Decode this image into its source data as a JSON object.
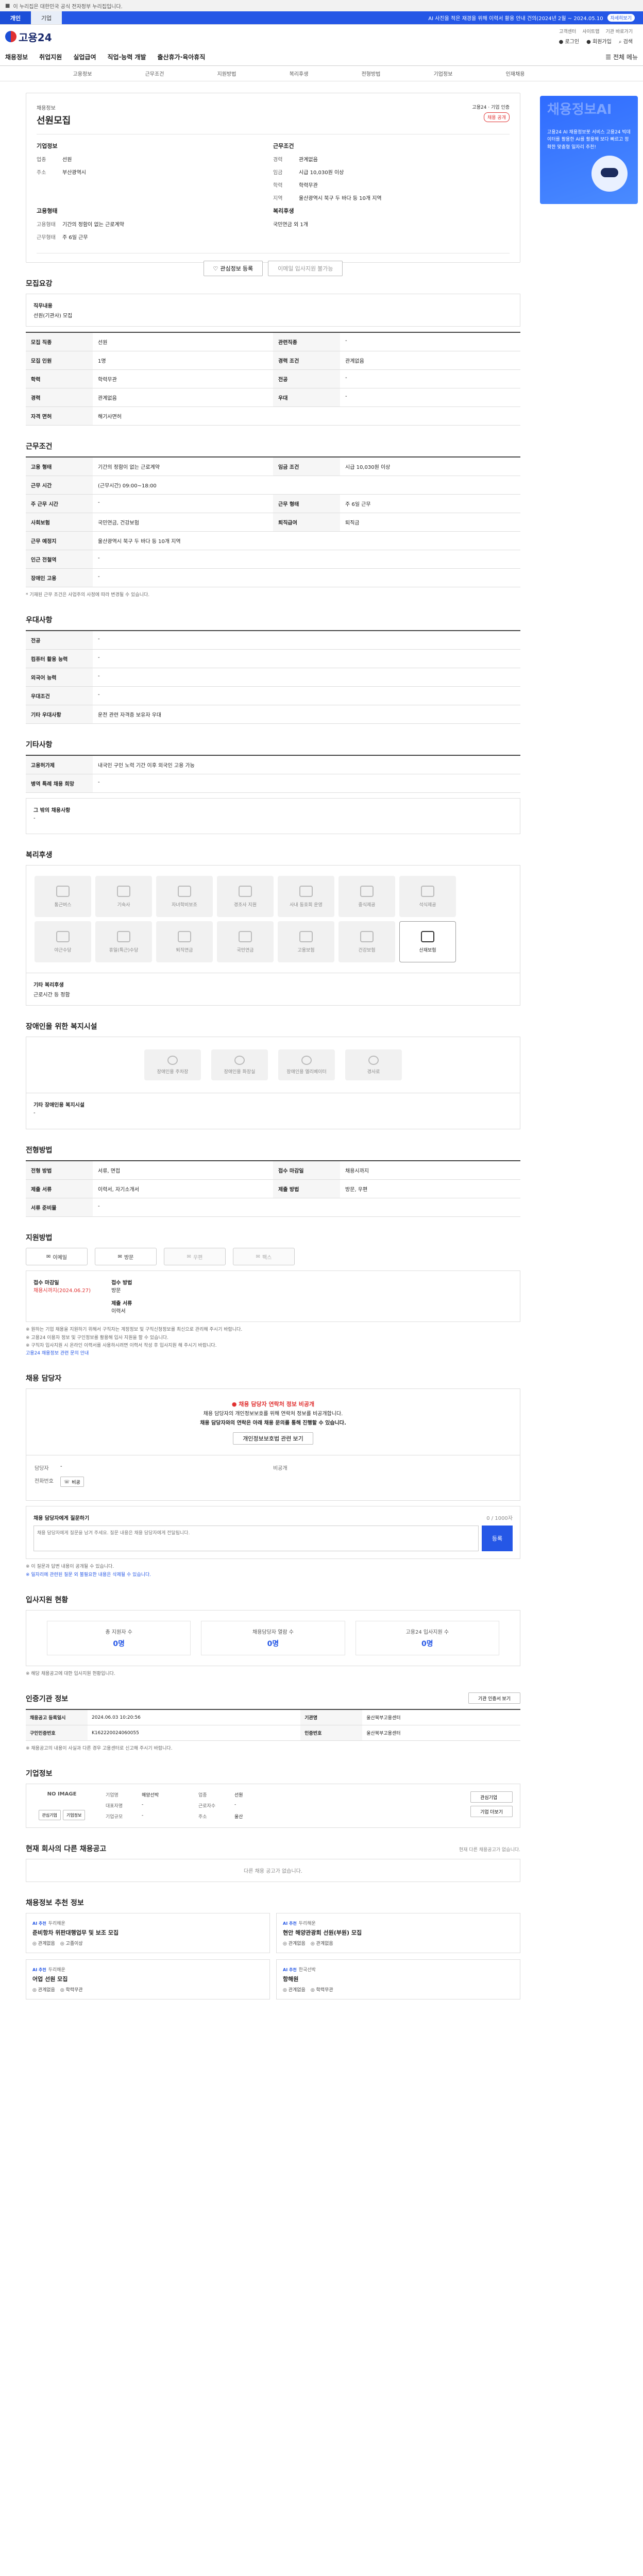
{
  "gov_strip": "이 누리집은 대한민국 공식 전자정부 누리집입니다.",
  "tabs": [
    "개인",
    "기업"
  ],
  "notice": {
    "text": "AI 사진을 적은 재경을 위해 이력서 활용 안내 건의(2024년 2월 ~ 2024.05.10",
    "more": "자세히보기"
  },
  "logo_text": "고용24",
  "header_top": [
    "고객센터",
    "사이트맵",
    "기관 바로가기"
  ],
  "header_utils": [
    "로그인",
    "회원가입",
    "검색"
  ],
  "nav": [
    "채용정보",
    "취업지원",
    "실업급여",
    "직업·능력 개발",
    "출산휴가·육아휴직"
  ],
  "all_menu": "전체 메뉴",
  "subnav": [
    "고용정보",
    "근무조건",
    "지원방법",
    "복리후생",
    "전형방법",
    "기업정보",
    "인재채용"
  ],
  "banner": {
    "big": "채용정보AI",
    "text": "고용24 AI 채용정보봇 서비스\n고용24 빅데이터를 활용한 AI를 활용해 보다 빠르고 정확한 맞춤형 일자리 추천!"
  },
  "job": {
    "label": "채용정보",
    "title": "선원모집",
    "corp_logo": "고용24 · 기업 인증",
    "badge": "채용 공개",
    "company_h": "기업정보",
    "company": [
      {
        "k": "업종",
        "v": "선원"
      },
      {
        "k": "주소",
        "v": "부산광역시"
      }
    ],
    "cond_h": "근무조건",
    "cond": [
      {
        "k": "경력",
        "v": "관계없음"
      },
      {
        "k": "임금",
        "v": "시급 10,030원 이상"
      },
      {
        "k": "학력",
        "v": "학력무관"
      },
      {
        "k": "지역",
        "v": "울산광역시 북구 두 바다 등 10개 지역"
      }
    ],
    "form_h": "고용형태",
    "form": [
      {
        "k": "고용형태",
        "v": "기간의 정함이 없는 근로계약"
      },
      {
        "k": "근무형태",
        "v": "주 6일 근무"
      }
    ],
    "welfare_h": "복리후생",
    "welfare": "국민연금 외 1개",
    "btn_save": "관심정보 등록",
    "btn_apply": "이메일 입사지원 불가능"
  },
  "sec_recruit": {
    "h": "모집요강",
    "duty_label": "직무내용",
    "duty": "선원(기관사) 모집",
    "rows": [
      [
        "모집 직종",
        "선원",
        "관련직종",
        "-"
      ],
      [
        "모집 인원",
        "1명",
        "경력 조건",
        "관계없음"
      ],
      [
        "학력",
        "학력무관",
        "전공",
        "-"
      ],
      [
        "경력",
        "관계없음",
        "우대",
        "-"
      ],
      [
        "자격 면허",
        "해기사면허",
        "",
        ""
      ]
    ]
  },
  "sec_work": {
    "h": "근무조건",
    "rows": [
      [
        "고용 형태",
        "기간의 정함이 없는 근로계약",
        "임금 조건",
        "시급 10,030원 이상"
      ],
      [
        "근무 시간",
        "(근무시간) 09:00~18:00",
        "",
        ""
      ],
      [
        "주 근무 시간",
        "-",
        "근무 형태",
        "주 6일 근무"
      ],
      [
        "사회보험",
        "국민연금, 건강보험",
        "퇴직급여",
        "퇴직금"
      ],
      [
        "근무 예정지",
        "울산광역시 북구 두 바다 등 10개 지역",
        "",
        ""
      ],
      [
        "인근 전철역",
        "-",
        "",
        ""
      ],
      [
        "장애인 고용",
        "-",
        "",
        ""
      ]
    ],
    "note": "* 기재된 근무 조건은 사업주의 사정에 따라 변경될 수 있습니다."
  },
  "sec_pref": {
    "h": "우대사항",
    "rows": [
      [
        "전공",
        "-"
      ],
      [
        "컴퓨터 활용 능력",
        "-"
      ],
      [
        "외국어 능력",
        "-"
      ],
      [
        "우대조건",
        "-"
      ],
      [
        "기타 우대사항",
        "운전 관련 자격증 보유자 우대"
      ]
    ]
  },
  "sec_etc": {
    "h": "기타사항",
    "rows": [
      [
        "고용허가제",
        "내국인 구인 노력 기간 이후 외국인 고용 가능"
      ],
      [
        "병역 특례 채용 희망",
        "-"
      ]
    ],
    "etc_label": "그 밖의 채용사항",
    "etc": "-"
  },
  "sec_benefit": {
    "h": "복리후생",
    "items": [
      "통근버스",
      "기숙사",
      "자녀학비보조",
      "경조사 지원",
      "사내 동호회 운영",
      "중식제공",
      "석식제공",
      "야근수당",
      "휴일(특근)수당",
      "퇴직연금",
      "국민연금",
      "고용보험",
      "건강보험",
      "산재보험"
    ],
    "active": "산재보험",
    "etc_label": "기타 복리후생",
    "etc": "근로시간 등 정함"
  },
  "sec_disabled": {
    "h": "장애인을 위한 복지시설",
    "items": [
      "장애인용 주차장",
      "장애인용 화장실",
      "장애인용 엘리베이터",
      "경사로"
    ],
    "etc_label": "기타 장애인용 복지시설",
    "etc": "-"
  },
  "sec_hire": {
    "h": "전형방법",
    "rows": [
      [
        "전형 방법",
        "서류, 면접",
        "접수 마감일",
        "채용시까지"
      ],
      [
        "제출 서류",
        "이력서, 자기소개서",
        "제출 방법",
        "방문, 우편"
      ],
      [
        "서류 준비물",
        "-",
        "",
        ""
      ]
    ]
  },
  "sec_apply": {
    "h": "지원방법",
    "methods": [
      "이메일",
      "방문",
      "우편",
      "팩스"
    ],
    "dim": [
      "우편",
      "팩스"
    ],
    "detail_label": "접수 마감일",
    "detail_value": "채용시까지(2024.06.27)",
    "doc_label": "접수 방법",
    "doc_value": "방문",
    "submit_label": "제출 서류",
    "submit_value": "이력서",
    "notes": [
      "※ 원하는 기업 채용을 지원하기 위해서 구직자는 계정정보 및 구직신청정보를 최신으로 관리해 주시기 바랍니다.",
      "※ 고용24 이용자 정보 및 구인정보를 활용해 입사 지원을 할 수 있습니다.",
      "※ 구직자 입사지원 시 온라인 이력서를 사용하시려면 이력서 작성 후 입사지원 해 주시기 바랍니다."
    ],
    "link": "고용24 채용정보 관련 문의 안내"
  },
  "sec_contact": {
    "h": "채용 담당자",
    "alert_title": "채용 담당자 연락처 정보 비공개",
    "alert_lines": [
      "채용 담당자의 개인정보보호를 위해 연락처 정보를 비공개합니다.",
      "채용 담당자와의 연락은 아래 채용 문의를 통해 진행할 수 있습니다."
    ],
    "alert_btn": "개인정보보호법 관련 보기",
    "name_label": "담당자",
    "name_value": "-",
    "phone_label": "전화번호",
    "phone_value": "비공개",
    "phone_btn": "비공",
    "q_label": "채용 담당자에게 질문하기",
    "q_count": "0 / 1000자",
    "q_placeholder": "채용 담당자에게 질문을 남겨 주세요. 질문 내용은 채용 담당자에게 전달됩니다.",
    "q_btn": "등록",
    "notes": [
      "※ 이 질문과 답변 내용이 공개될 수 있습니다.",
      "※ 일자리에 관련된 질문 외 불필요한 내용은 삭제될 수 있습니다."
    ]
  },
  "sec_status": {
    "h": "입사지원 현황",
    "items": [
      {
        "label": "총 지원자 수",
        "value": "0명"
      },
      {
        "label": "채용담당자 열람 수",
        "value": "0명"
      },
      {
        "label": "고용24 입사지원 수",
        "value": "0명"
      }
    ],
    "note": "※ 해당 채용공고에 대한 입사지원 현황입니다."
  },
  "sec_info": {
    "h": "인증기관 정보",
    "btn": "기관 인증서 보기",
    "rows": [
      [
        "채용공고 등록일시",
        "2024.06.03 10:20:56",
        "기관명",
        "울산북부고용센터"
      ],
      [
        "구인인증번호",
        "K162220024060055",
        "인증번호",
        "울산북부고용센터"
      ]
    ],
    "notes": [
      "※ 채용공고의 내용이 사실과 다른 경우 고용센터로 신고해 주시기 바랍니다."
    ]
  },
  "sec_company": {
    "h": "기업정보",
    "logo": "NO IMAGE",
    "btns": [
      "관심기업",
      "기업정보"
    ],
    "grid": [
      [
        "기업명",
        "해양선박",
        "업종",
        "선원"
      ],
      [
        "대표자명",
        "-",
        "근로자수",
        "-"
      ],
      [
        "기업규모",
        "-",
        "주소",
        "울산"
      ]
    ],
    "side_btns": [
      "관심기업",
      "기업 더보기"
    ]
  },
  "sec_other": {
    "h": "현재 회사의 다른 채용공고",
    "right": "현재 다른 채용공고가 없습니다.",
    "empty": "다른 채용 공고가 없습니다."
  },
  "sec_rec": {
    "h": "채용정보 추천 정보",
    "items": [
      {
        "co": "두리해운",
        "badge": "AI 추천",
        "title": "준비항차 위판대행업무 및 보조 모집",
        "meta": [
          "관계없음",
          "고졸이상"
        ]
      },
      {
        "co": "두리해운",
        "badge": "AI 추천",
        "title": "현안 해양관광회 선원(부원) 모집",
        "meta": [
          "관계없음",
          "관계없음"
        ]
      },
      {
        "co": "두리해운",
        "badge": "AI 추천",
        "title": "어업 선원 모집",
        "meta": [
          "관계없음",
          "학력무관"
        ]
      },
      {
        "co": "한국선박",
        "badge": "AI 추천",
        "title": "항해원",
        "meta": [
          "관계없음",
          "학력무관"
        ]
      }
    ]
  },
  "colors": {
    "brand": "#2557e6",
    "alert": "#e03131"
  }
}
